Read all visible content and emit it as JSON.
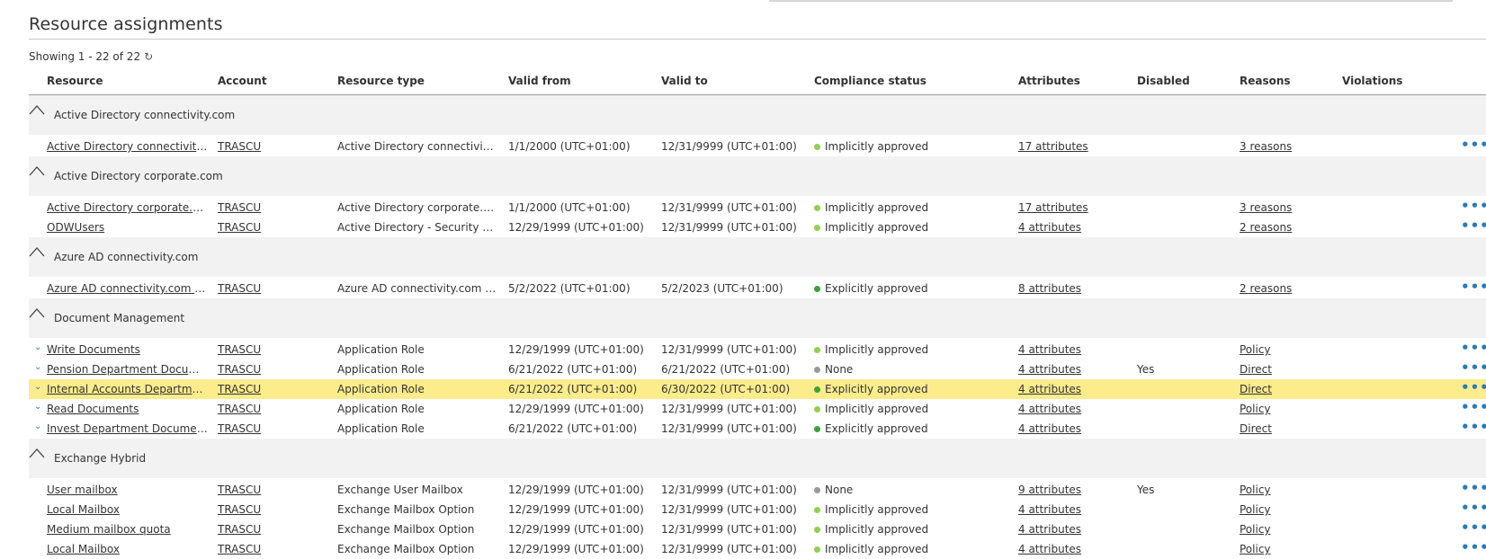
{
  "page": {
    "title": "Resource assignments",
    "showing": "Showing 1 - 22 of 22"
  },
  "colors": {
    "implicit": "#8fd14f",
    "explicit": "#3aa33a",
    "none": "#999999",
    "highlight": "#fcec8c",
    "accent": "#2a7ab8"
  },
  "columns": {
    "resource": "Resource",
    "account": "Account",
    "resource_type": "Resource type",
    "valid_from": "Valid from",
    "valid_to": "Valid to",
    "compliance": "Compliance status",
    "attributes": "Attributes",
    "disabled": "Disabled",
    "reasons": "Reasons",
    "violations": "Violations"
  },
  "groups": [
    {
      "label": "Active Directory connectivity.com",
      "rows": [
        {
          "resource": "Active Directory connectivity.com Acc...",
          "account": "TRASCU",
          "type": "Active Directory connectivity.com Acc...",
          "from": "1/1/2000 (UTC+01:00)",
          "to": "12/31/9999 (UTC+01:00)",
          "status": "Implicitly approved",
          "status_kind": "implicit",
          "attributes": "17 attributes",
          "disabled": "",
          "reasons": "3 reasons",
          "chevron": false,
          "highlighted": false
        }
      ]
    },
    {
      "label": "Active Directory corporate.com",
      "rows": [
        {
          "resource": "Active Directory corporate.com Account",
          "account": "TRASCU",
          "type": "Active Directory corporate.com Account",
          "from": "1/1/2000 (UTC+01:00)",
          "to": "12/31/9999 (UTC+01:00)",
          "status": "Implicitly approved",
          "status_kind": "implicit",
          "attributes": "17 attributes",
          "disabled": "",
          "reasons": "3 reasons",
          "chevron": false,
          "highlighted": false
        },
        {
          "resource": "ODWUsers",
          "account": "TRASCU",
          "type": "Active Directory - Security Group",
          "from": "12/29/1999 (UTC+01:00)",
          "to": "12/31/9999 (UTC+01:00)",
          "status": "Implicitly approved",
          "status_kind": "implicit",
          "attributes": "4 attributes",
          "disabled": "",
          "reasons": "2 reasons",
          "chevron": false,
          "highlighted": false
        }
      ]
    },
    {
      "label": "Azure AD connectivity.com",
      "rows": [
        {
          "resource": "Azure AD connectivity.com Permanent...",
          "account": "TRASCU",
          "type": "Azure AD connectivity.com Account",
          "from": "5/2/2022 (UTC+01:00)",
          "to": "5/2/2023 (UTC+01:00)",
          "status": "Explicitly approved",
          "status_kind": "explicit",
          "attributes": "8 attributes",
          "disabled": "",
          "reasons": "2 reasons",
          "chevron": false,
          "highlighted": false
        }
      ]
    },
    {
      "label": "Document Management",
      "rows": [
        {
          "resource": "Write Documents",
          "account": "TRASCU",
          "type": "Application Role",
          "from": "12/29/1999 (UTC+01:00)",
          "to": "12/31/9999 (UTC+01:00)",
          "status": "Implicitly approved",
          "status_kind": "implicit",
          "attributes": "4 attributes",
          "disabled": "",
          "reasons": "Policy",
          "chevron": true,
          "highlighted": false
        },
        {
          "resource": "Pension Department Documents",
          "account": "TRASCU",
          "type": "Application Role",
          "from": "6/21/2022 (UTC+01:00)",
          "to": "6/21/2022 (UTC+01:00)",
          "status": "None",
          "status_kind": "none",
          "attributes": "4 attributes",
          "disabled": "Yes",
          "reasons": "Direct",
          "chevron": true,
          "highlighted": false
        },
        {
          "resource": "Internal Accounts Department Documents",
          "account": "TRASCU",
          "type": "Application Role",
          "from": "6/21/2022 (UTC+01:00)",
          "to": "6/30/2022 (UTC+01:00)",
          "status": "Explicitly approved",
          "status_kind": "explicit",
          "attributes": "4 attributes",
          "disabled": "",
          "reasons": "Direct",
          "chevron": true,
          "highlighted": true
        },
        {
          "resource": "Read Documents",
          "account": "TRASCU",
          "type": "Application Role",
          "from": "12/29/1999 (UTC+01:00)",
          "to": "12/31/9999 (UTC+01:00)",
          "status": "Implicitly approved",
          "status_kind": "implicit",
          "attributes": "4 attributes",
          "disabled": "",
          "reasons": "Policy",
          "chevron": true,
          "highlighted": false
        },
        {
          "resource": "Invest Department Documents",
          "account": "TRASCU",
          "type": "Application Role",
          "from": "6/21/2022 (UTC+01:00)",
          "to": "12/31/9999 (UTC+01:00)",
          "status": "Explicitly approved",
          "status_kind": "explicit",
          "attributes": "4 attributes",
          "disabled": "",
          "reasons": "Direct",
          "chevron": true,
          "highlighted": false
        }
      ]
    },
    {
      "label": "Exchange Hybrid",
      "rows": [
        {
          "resource": "User mailbox",
          "account": "TRASCU",
          "type": "Exchange User Mailbox",
          "from": "12/29/1999 (UTC+01:00)",
          "to": "12/31/9999 (UTC+01:00)",
          "status": "None",
          "status_kind": "none",
          "attributes": "9 attributes",
          "disabled": "Yes",
          "reasons": "Policy",
          "chevron": false,
          "highlighted": false
        },
        {
          "resource": "Local Mailbox",
          "account": "TRASCU",
          "type": "Exchange Mailbox Option",
          "from": "12/29/1999 (UTC+01:00)",
          "to": "12/31/9999 (UTC+01:00)",
          "status": "Implicitly approved",
          "status_kind": "implicit",
          "attributes": "4 attributes",
          "disabled": "",
          "reasons": "Policy",
          "chevron": false,
          "highlighted": false
        },
        {
          "resource": "Medium mailbox quota",
          "account": "TRASCU",
          "type": "Exchange Mailbox Option",
          "from": "12/29/1999 (UTC+01:00)",
          "to": "12/31/9999 (UTC+01:00)",
          "status": "Implicitly approved",
          "status_kind": "implicit",
          "attributes": "4 attributes",
          "disabled": "",
          "reasons": "Policy",
          "chevron": false,
          "highlighted": false
        },
        {
          "resource": "Local Mailbox",
          "account": "TRASCU",
          "type": "Exchange Mailbox Option",
          "from": "12/29/1999 (UTC+01:00)",
          "to": "12/31/9999 (UTC+01:00)",
          "status": "Implicitly approved",
          "status_kind": "implicit",
          "attributes": "4 attributes",
          "disabled": "",
          "reasons": "Policy",
          "chevron": false,
          "highlighted": false
        }
      ]
    }
  ]
}
